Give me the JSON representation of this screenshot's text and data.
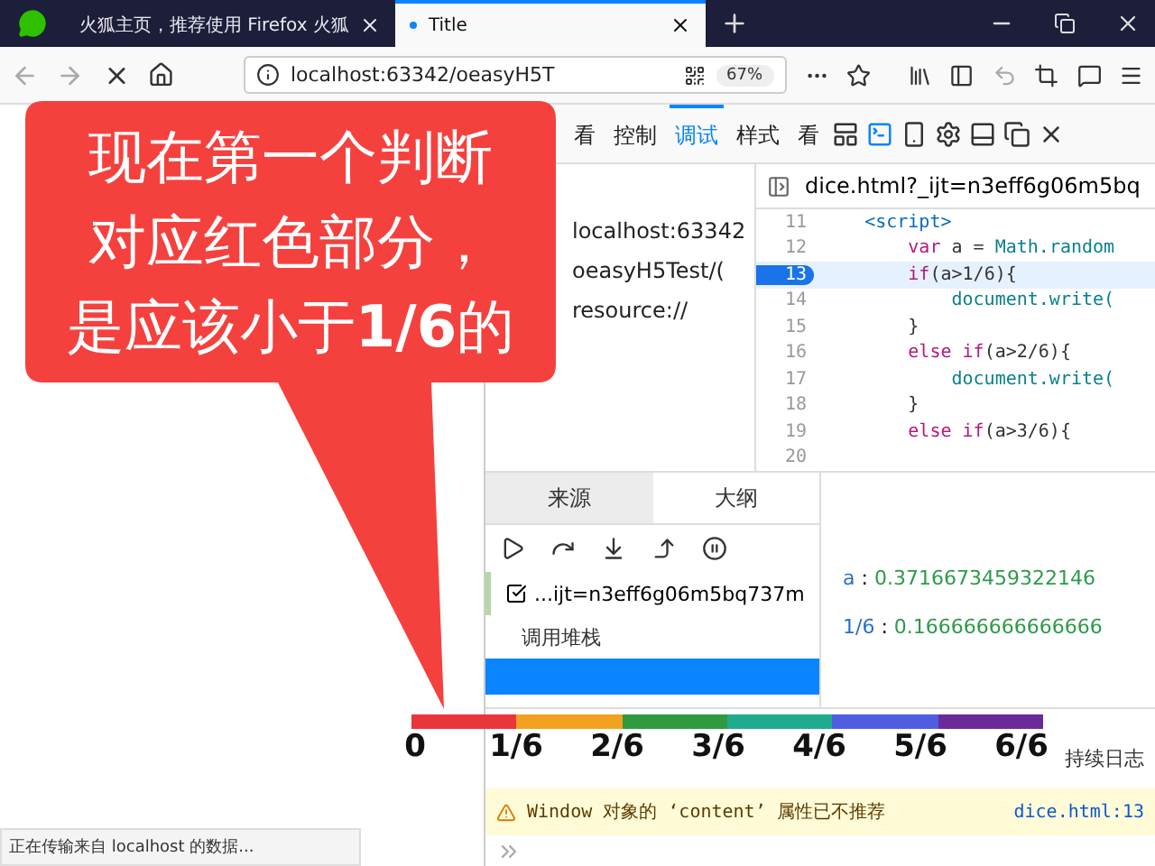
{
  "browser_tabs": [
    {
      "label": "火狐主页，推荐使用 Firefox 火狐",
      "selected": false
    },
    {
      "label": "Title",
      "selected": true
    }
  ],
  "address_bar": {
    "url": "localhost:63342/oeasyH5T",
    "zoom": "67%"
  },
  "status_bar": "正在传输来自 localhost 的数据...",
  "devtools": {
    "tabs": [
      {
        "label": "看",
        "selected": false
      },
      {
        "label": "控制",
        "selected": false
      },
      {
        "label": "调试",
        "selected": true
      },
      {
        "label": "样式",
        "selected": false
      },
      {
        "label": "看",
        "selected": false
      }
    ],
    "sources": [
      "localhost:63342",
      "oeasyH5Test/(",
      "resource://"
    ],
    "file_tab": "dice.html?_ijt=n3eff6g06m5bq",
    "code_lines": [
      {
        "number": "11",
        "current": false,
        "tokens": [
          {
            "kind": "tag",
            "text": "    <script>"
          }
        ]
      },
      {
        "number": "12",
        "current": false,
        "tokens": [
          {
            "kind": "keyword",
            "text": "        var "
          },
          {
            "kind": "plain",
            "text": "a = "
          },
          {
            "kind": "ident",
            "text": "Math.random"
          }
        ]
      },
      {
        "number": "13",
        "current": true,
        "tokens": [
          {
            "kind": "keyword",
            "text": "        if"
          },
          {
            "kind": "plain",
            "text": "(a>1/6){"
          }
        ]
      },
      {
        "number": "14",
        "current": false,
        "tokens": [
          {
            "kind": "ident",
            "text": "            document.write("
          }
        ]
      },
      {
        "number": "15",
        "current": false,
        "tokens": [
          {
            "kind": "plain",
            "text": "        }"
          }
        ]
      },
      {
        "number": "16",
        "current": false,
        "tokens": [
          {
            "kind": "keyword",
            "text": "        else if"
          },
          {
            "kind": "plain",
            "text": "(a>2/6){"
          }
        ]
      },
      {
        "number": "17",
        "current": false,
        "tokens": [
          {
            "kind": "ident",
            "text": "            document.write("
          }
        ]
      },
      {
        "number": "18",
        "current": false,
        "tokens": [
          {
            "kind": "plain",
            "text": "        }"
          }
        ]
      },
      {
        "number": "19",
        "current": false,
        "tokens": [
          {
            "kind": "keyword",
            "text": "        else if"
          },
          {
            "kind": "plain",
            "text": "(a>3/6){"
          }
        ]
      },
      {
        "number": "20",
        "current": false
      }
    ],
    "pane_tabs": [
      {
        "label": "来源",
        "selected": true
      },
      {
        "label": "大纲",
        "selected": false
      }
    ],
    "breakpoint": {
      "label": "...ijt=n3eff6g06m5bq737m",
      "checked": true
    },
    "call_stack_title": "调用堆栈",
    "variables": [
      {
        "name": "a",
        "separator": ":",
        "value": "0.3716673459322146"
      },
      {
        "name": "1/6",
        "separator": ":",
        "value": "0.166666666666666"
      }
    ],
    "persist_logs": "持续日志",
    "warning": {
      "message": "Window 对象的 ‘content’ 属性已不推荐",
      "source": "dice.html:13"
    }
  },
  "callout": {
    "lines": [
      "现在第一个判断",
      "对应红色部分，",
      "是应该小于**1/6**的"
    ]
  },
  "scale": {
    "segments": [
      {
        "color": "#e8363c"
      },
      {
        "color": "#f2a11f"
      },
      {
        "color": "#2f9a3e"
      },
      {
        "color": "#1fab8e"
      },
      {
        "color": "#4f5de0"
      },
      {
        "color": "#6b2a9a"
      }
    ],
    "labels": [
      "0",
      "1/6",
      "2/6",
      "3/6",
      "4/6",
      "5/6",
      "6/6"
    ]
  }
}
